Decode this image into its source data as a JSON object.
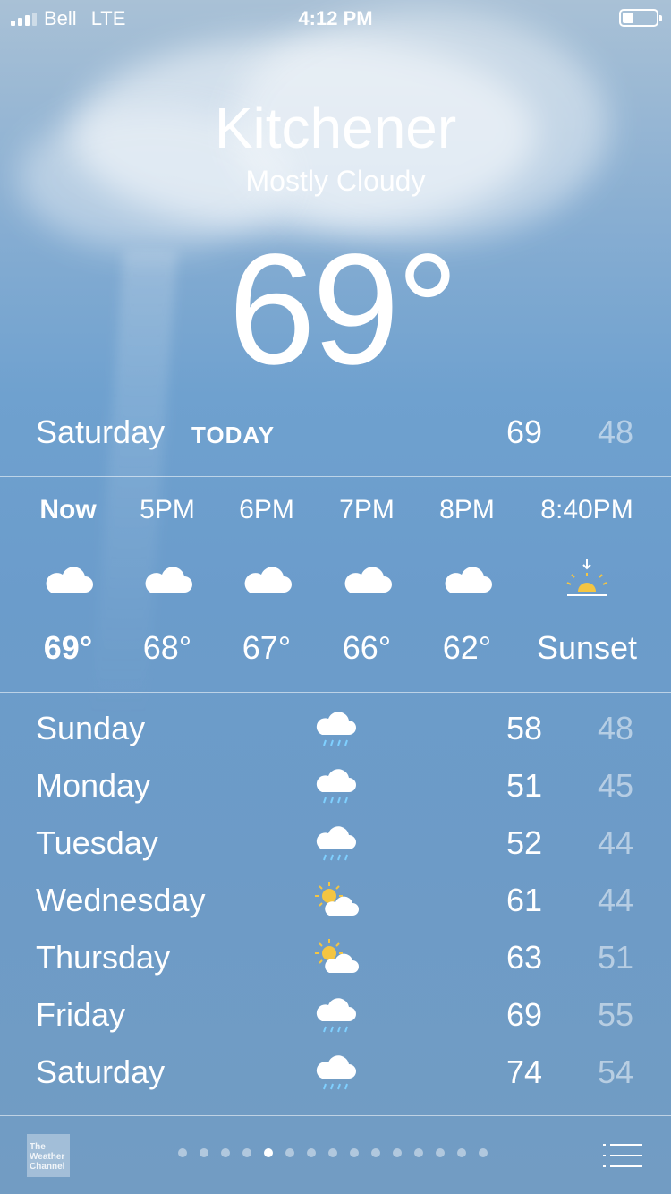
{
  "status_bar": {
    "carrier": "Bell",
    "network": "LTE",
    "time": "4:12 PM"
  },
  "location": {
    "city": "Kitchener",
    "condition": "Mostly Cloudy",
    "temperature": "69°"
  },
  "today": {
    "day": "Saturday",
    "tag": "TODAY",
    "high": "69",
    "low": "48"
  },
  "hourly": [
    {
      "time": "Now",
      "icon": "cloud-icon",
      "value": "69°"
    },
    {
      "time": "5PM",
      "icon": "cloud-icon",
      "value": "68°"
    },
    {
      "time": "6PM",
      "icon": "cloud-icon",
      "value": "67°"
    },
    {
      "time": "7PM",
      "icon": "cloud-icon",
      "value": "66°"
    },
    {
      "time": "8PM",
      "icon": "cloud-icon",
      "value": "62°"
    },
    {
      "time": "8:40PM",
      "icon": "sunset-icon",
      "value": "Sunset"
    }
  ],
  "daily": [
    {
      "day": "Sunday",
      "icon": "rain-icon",
      "high": "58",
      "low": "48"
    },
    {
      "day": "Monday",
      "icon": "rain-icon",
      "high": "51",
      "low": "45"
    },
    {
      "day": "Tuesday",
      "icon": "rain-icon",
      "high": "52",
      "low": "44"
    },
    {
      "day": "Wednesday",
      "icon": "partly-cloudy-icon",
      "high": "61",
      "low": "44"
    },
    {
      "day": "Thursday",
      "icon": "partly-cloudy-icon",
      "high": "63",
      "low": "51"
    },
    {
      "day": "Friday",
      "icon": "rain-icon",
      "high": "69",
      "low": "55"
    },
    {
      "day": "Saturday",
      "icon": "rain-icon",
      "high": "74",
      "low": "54"
    }
  ],
  "footer": {
    "logo_text": "The Weather Channel",
    "page_count": 15,
    "active_page_index": 4
  },
  "colors": {
    "sun": "#f4c542",
    "rain": "#7fd0ff",
    "low_temp": "rgba(255,255,255,0.5)"
  }
}
